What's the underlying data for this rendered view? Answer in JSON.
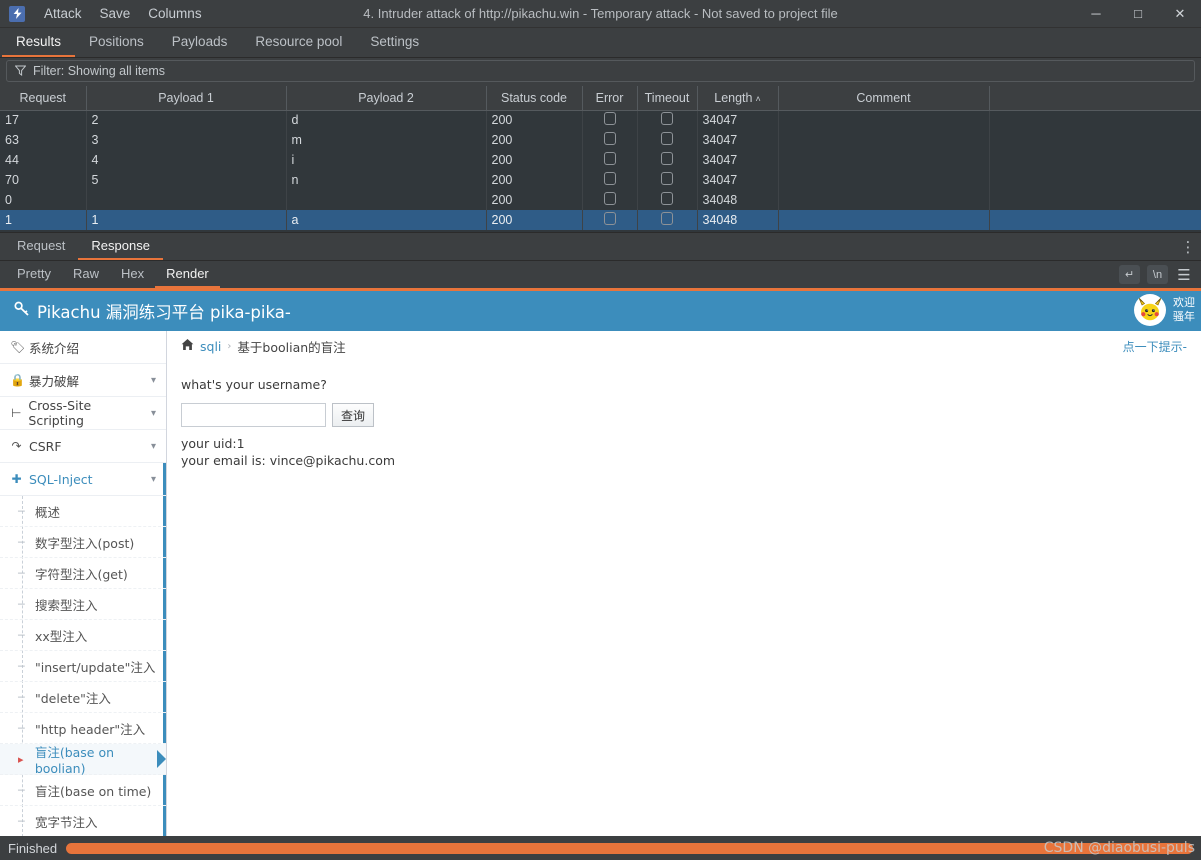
{
  "titlebar": {
    "logo": "burp-logo",
    "menus": [
      "Attack",
      "Save",
      "Columns"
    ],
    "window_title": "4. Intruder attack of http://pikachu.win - Temporary attack - Not saved to project file",
    "controls": [
      {
        "name": "minimize-button",
        "glyph": "─"
      },
      {
        "name": "maximize-button",
        "glyph": "□"
      },
      {
        "name": "close-button",
        "glyph": "✕"
      }
    ]
  },
  "tabs": [
    {
      "label": "Results",
      "active": true
    },
    {
      "label": "Positions",
      "active": false
    },
    {
      "label": "Payloads",
      "active": false
    },
    {
      "label": "Resource pool",
      "active": false
    },
    {
      "label": "Settings",
      "active": false
    }
  ],
  "filter": {
    "icon": "filter-icon",
    "text": "Filter: Showing all items"
  },
  "results_table": {
    "columns": [
      "Request",
      "Payload 1",
      "Payload 2",
      "Status code",
      "Error",
      "Timeout",
      "Length",
      "Comment"
    ],
    "sorted_column": "Length",
    "sort_indicator": "˄",
    "rows": [
      {
        "request": "17",
        "payload1": "2",
        "payload2": "d",
        "status": "200",
        "error": false,
        "timeout": false,
        "length": "34047",
        "comment": "",
        "selected": false
      },
      {
        "request": "63",
        "payload1": "3",
        "payload2": "m",
        "status": "200",
        "error": false,
        "timeout": false,
        "length": "34047",
        "comment": "",
        "selected": false
      },
      {
        "request": "44",
        "payload1": "4",
        "payload2": "i",
        "status": "200",
        "error": false,
        "timeout": false,
        "length": "34047",
        "comment": "",
        "selected": false
      },
      {
        "request": "70",
        "payload1": "5",
        "payload2": "n",
        "status": "200",
        "error": false,
        "timeout": false,
        "length": "34047",
        "comment": "",
        "selected": false
      },
      {
        "request": "0",
        "payload1": "",
        "payload2": "",
        "status": "200",
        "error": false,
        "timeout": false,
        "length": "34048",
        "comment": "",
        "selected": false
      },
      {
        "request": "1",
        "payload1": "1",
        "payload2": "a",
        "status": "200",
        "error": false,
        "timeout": false,
        "length": "34048",
        "comment": "",
        "selected": true
      }
    ]
  },
  "message_tabs": [
    {
      "label": "Request",
      "active": false
    },
    {
      "label": "Response",
      "active": true
    }
  ],
  "message_menu_icon": "kebab-menu-icon",
  "view_tabs": [
    {
      "label": "Pretty",
      "active": false
    },
    {
      "label": "Raw",
      "active": false
    },
    {
      "label": "Hex",
      "active": false
    },
    {
      "label": "Render",
      "active": true
    }
  ],
  "view_icons": [
    {
      "name": "word-wrap-icon",
      "glyph": "↵"
    },
    {
      "name": "show-newlines-icon",
      "glyph": "\\n"
    },
    {
      "name": "response-menu-icon",
      "glyph": "☰"
    }
  ],
  "rendered_page": {
    "header": {
      "brand_icon": "key-icon",
      "brand": "Pikachu 漏洞练习平台 pika-pika-",
      "avatar": "pikachu-avatar",
      "welcome_line1": "欢迎",
      "welcome_line2": "骚年",
      "bg_color": "#3c8dbc"
    },
    "sidebar": [
      {
        "label": "系统介绍",
        "icon": "tag-icon",
        "chevron": false,
        "active": false
      },
      {
        "label": "暴力破解",
        "icon": "lock-icon",
        "chevron": true,
        "active": false
      },
      {
        "label": "Cross-Site Scripting",
        "icon": "branch-icon",
        "chevron": true,
        "active": false
      },
      {
        "label": "CSRF",
        "icon": "external-link-icon",
        "chevron": true,
        "active": false
      },
      {
        "label": "SQL-Inject",
        "icon": "needle-icon",
        "chevron": true,
        "active": true
      }
    ],
    "submenu": [
      {
        "label": "概述",
        "current": false
      },
      {
        "label": "数字型注入(post)",
        "current": false
      },
      {
        "label": "字符型注入(get)",
        "current": false
      },
      {
        "label": "搜索型注入",
        "current": false
      },
      {
        "label": "xx型注入",
        "current": false
      },
      {
        "label": "\"insert/update\"注入",
        "current": false
      },
      {
        "label": "\"delete\"注入",
        "current": false
      },
      {
        "label": "\"http header\"注入",
        "current": false
      },
      {
        "label": "盲注(base on boolian)",
        "current": true
      },
      {
        "label": "盲注(base on time)",
        "current": false
      },
      {
        "label": "宽字节注入",
        "current": false
      }
    ],
    "breadcrumb": {
      "home_icon": "home-icon",
      "root": "sqli",
      "separator": "›",
      "current": "基于boolian的盲注",
      "hint_link": "点一下提示-"
    },
    "form": {
      "question": "what's your username?",
      "input_value": "",
      "input_placeholder": "",
      "submit_label": "查询"
    },
    "result_lines": [
      "your uid:1",
      "your email is: vince@pikachu.com"
    ]
  },
  "statusbar": {
    "label": "Finished",
    "progress_percent": 100,
    "progress_color": "#e8743b",
    "watermark": "CSDN @diaobusi-puls"
  }
}
